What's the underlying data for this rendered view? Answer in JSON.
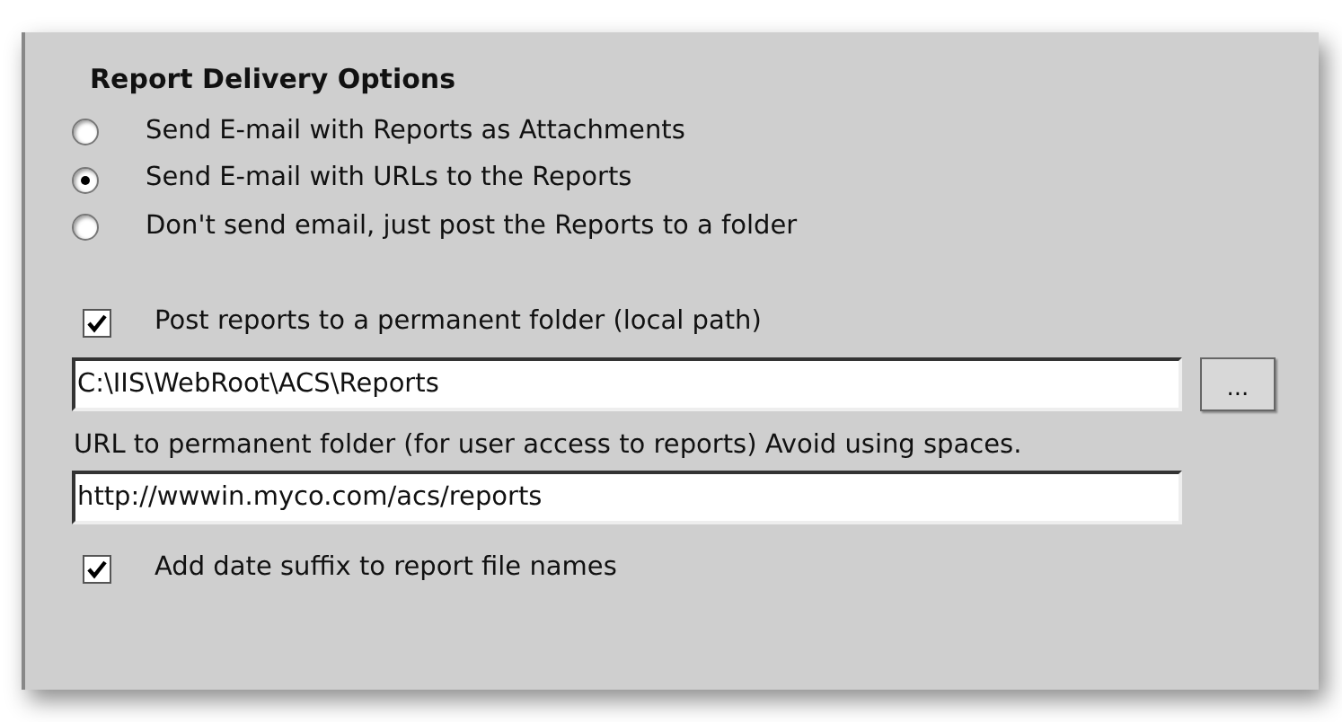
{
  "title": "Report Delivery Options",
  "delivery_options": [
    {
      "label": "Send E-mail with Reports as Attachments",
      "selected": false
    },
    {
      "label": "Send E-mail with URLs to the Reports",
      "selected": true
    },
    {
      "label": "Don't send email, just post the Reports to a folder",
      "selected": false
    }
  ],
  "post_to_folder": {
    "label": "Post reports to a permanent folder (local path)",
    "checked": true
  },
  "local_path": {
    "value": "C:\\IIS\\WebRoot\\ACS\\Reports"
  },
  "browse_button": "...",
  "url_label": "URL to permanent folder (for user access to reports) Avoid using spaces.",
  "url_field": {
    "value": "http://wwwin.myco.com/acs/reports"
  },
  "date_suffix": {
    "label": "Add date suffix to report file names",
    "checked": true
  }
}
